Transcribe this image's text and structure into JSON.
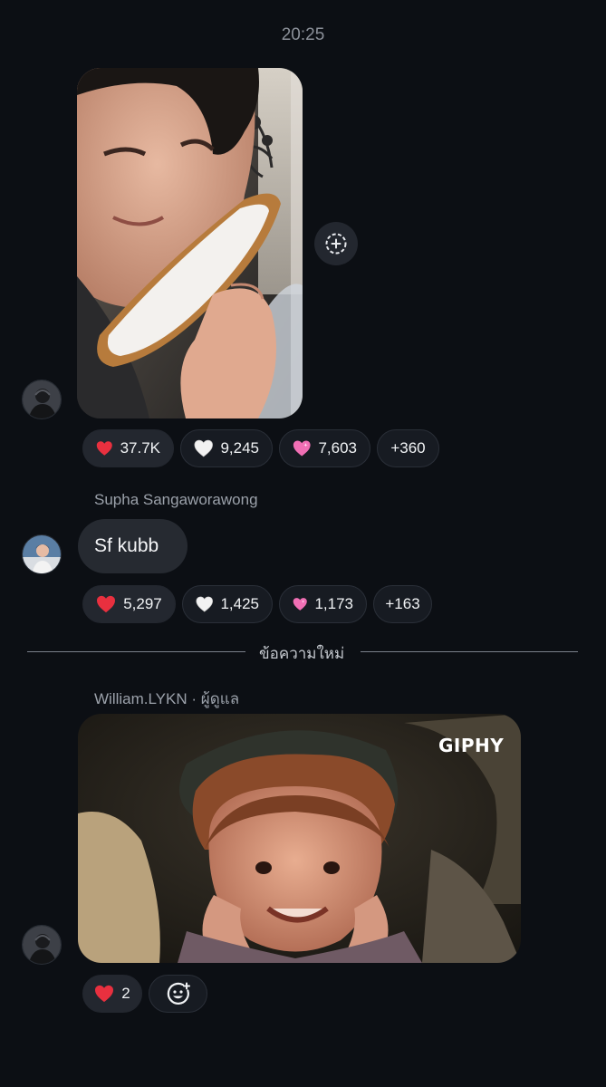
{
  "timestamp": "20:25",
  "message1": {
    "reactions": [
      {
        "emoji": "red-heart",
        "count": "37.7K",
        "color": "#e8303f",
        "active": true
      },
      {
        "emoji": "white-heart",
        "count": "9,245",
        "color": "#f2f2f2",
        "active": false
      },
      {
        "emoji": "pink-sparkle-heart",
        "count": "7,603",
        "color": "#f06fb4",
        "active": false
      }
    ],
    "more": "+360"
  },
  "message2": {
    "sender": "Supha Sangaworawong",
    "text": "Sf kubb",
    "reactions": [
      {
        "emoji": "red-heart",
        "count": "5,297",
        "color": "#e8303f",
        "active": true
      },
      {
        "emoji": "white-heart",
        "count": "1,425",
        "color": "#f2f2f2",
        "active": false
      },
      {
        "emoji": "pink-sparkle-heart",
        "count": "1,173",
        "color": "#f06fb4",
        "active": false
      }
    ],
    "more": "+163"
  },
  "divider": {
    "label": "ข้อความใหม่"
  },
  "message3": {
    "sender": "William.LYKN · ผู้ดูแล",
    "gif_label": "GIPHY",
    "reactions": [
      {
        "emoji": "red-heart",
        "count": "2",
        "color": "#e8303f",
        "active": true
      }
    ]
  },
  "icons": {
    "share": "add-circle-dashed-icon",
    "add_reaction": "add-reaction-icon"
  }
}
